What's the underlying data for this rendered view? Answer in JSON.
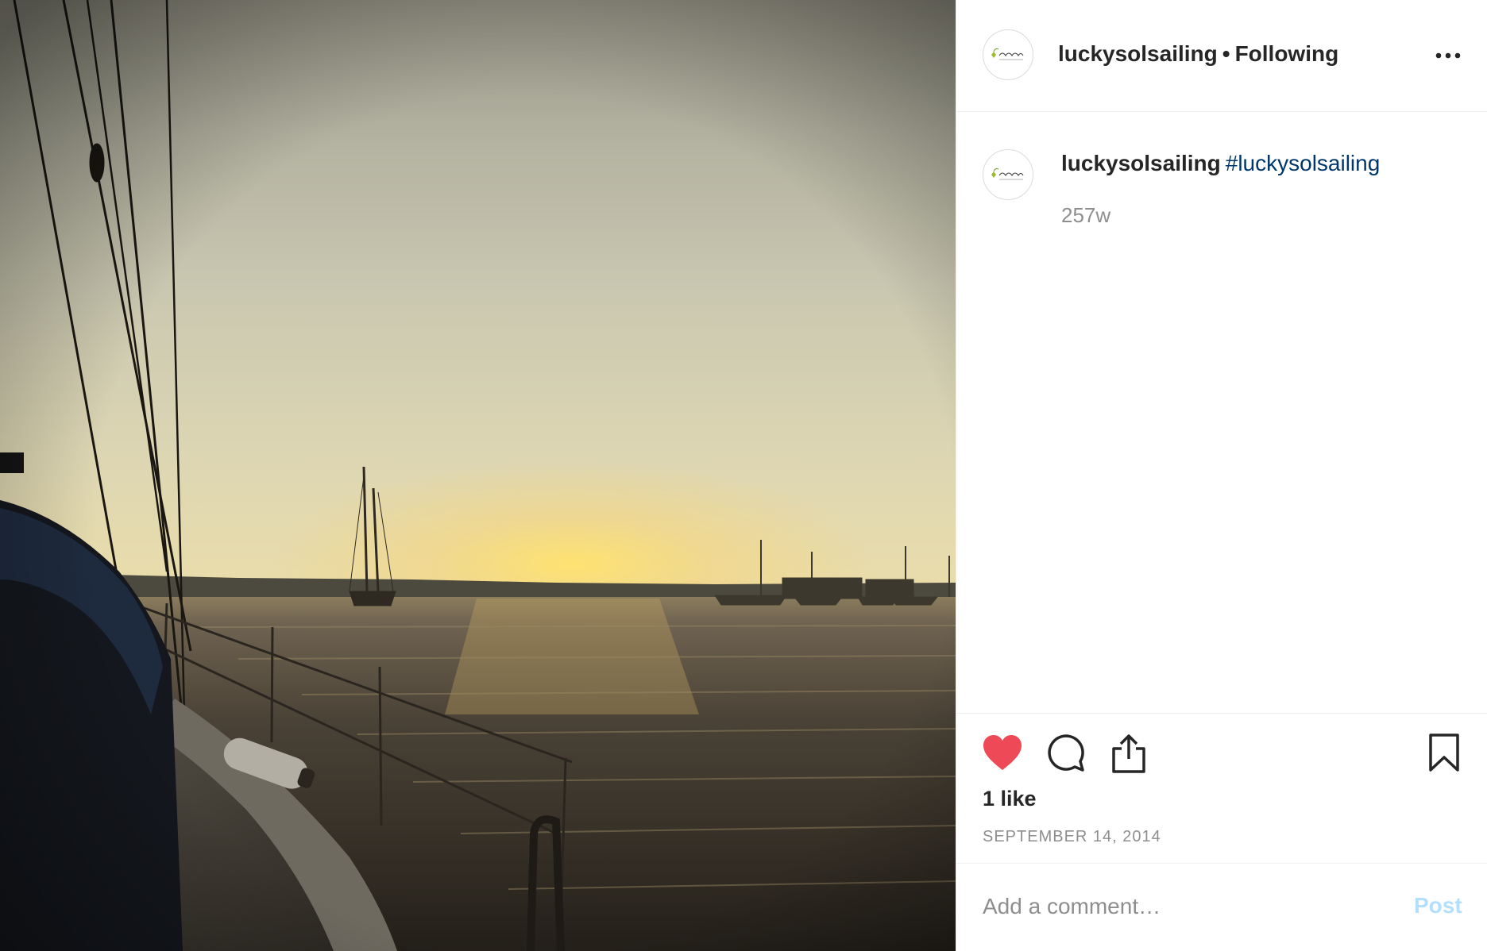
{
  "photo": {
    "alt": "",
    "colors": {
      "sky_top": "#959385",
      "glow": "#ffe26e",
      "water": "#2f2a22"
    }
  },
  "header": {
    "username": "luckysolsailing",
    "separator": "•",
    "follow_status": "Following",
    "more_icon": "more-horizontal-icon"
  },
  "caption": {
    "username": "luckysolsailing",
    "hashtag": "#luckysolsailing",
    "time_ago": "257w"
  },
  "actions": {
    "like_icon": "heart-filled-icon",
    "comment_icon": "comment-icon",
    "share_icon": "share-icon",
    "save_icon": "bookmark-icon",
    "likes_text": "1 like",
    "date": "SEPTEMBER 14, 2014"
  },
  "comment_box": {
    "placeholder": "Add a comment…",
    "post_label": "Post"
  },
  "colors": {
    "text": "#262626",
    "secondary": "#8e8e8e",
    "link": "#00376b",
    "like_red": "#ed4956",
    "post_disabled": "#b2dffc",
    "divider": "#efefef"
  }
}
